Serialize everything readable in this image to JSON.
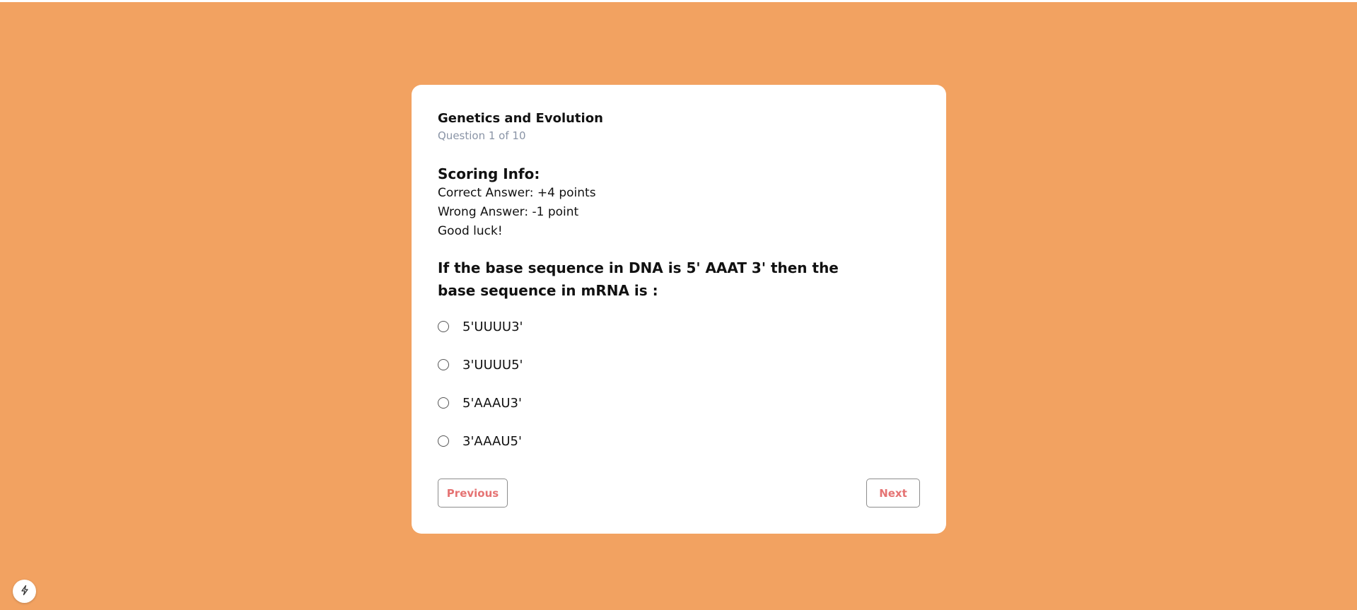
{
  "colors": {
    "background": "#f2a261",
    "card": "#ffffff",
    "accent_button_text": "#e57373",
    "muted_text": "#8a94a6"
  },
  "quiz": {
    "title": "Genetics and Evolution",
    "counter": "Question 1 of 10"
  },
  "scoring": {
    "heading": "Scoring Info:",
    "correct": "Correct Answer: +4 points",
    "wrong": "Wrong Answer: -1 point",
    "closing": "Good luck!"
  },
  "question": {
    "text": "If the base sequence in DNA is 5' AAAT 3' then the base sequence in mRNA is :",
    "options": [
      {
        "label": "5'UUUU3'"
      },
      {
        "label": "3'UUUU5'"
      },
      {
        "label": "5'AAAU3'"
      },
      {
        "label": "3'AAAU5'"
      }
    ],
    "selected": null
  },
  "navigation": {
    "previous_label": "Previous",
    "next_label": "Next"
  },
  "floating_button": {
    "icon": "lightning-icon"
  }
}
